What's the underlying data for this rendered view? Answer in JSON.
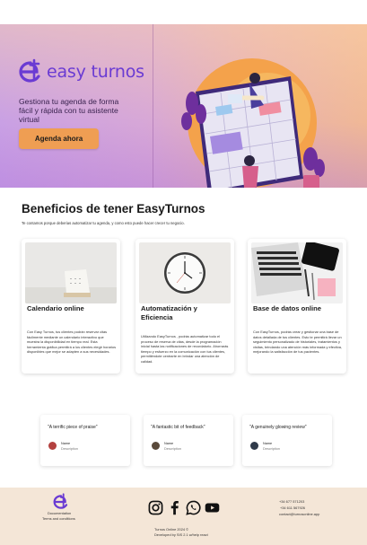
{
  "brand": {
    "name": "easy turnos"
  },
  "hero": {
    "tagline": "Gestiona tu agenda de forma fácil y rápida con tu asistente virtual",
    "cta_label": "Agenda ahora"
  },
  "benefits": {
    "title": "Beneficios de tener EasyTurnos",
    "subtitle": "Te contamos porque deberias automatizar tu agenda, y como esto puede hacer crecer tu negocio.",
    "cards": [
      {
        "title": "Calendario online",
        "body": "Con Easy Turnos, tus clientes podrán reservar citas fácilmente mediante un calendario interactivo que muestra la disponibilidad en tiempo real. Esta herramienta gráfica permitirá a los clientes elegir horarios disponibles que mejor se adapten a sus necesidades."
      },
      {
        "title": "Automatización y Eficiencia",
        "body": "Utilizando EasyTurnos , podrás automatizar todo el proceso de reserva de citas, desde la programación inicial hasta las notificaciones de recordatorio. Ahorrarás tiempo y esfuerzo en la comunicación con tus clientes, permitiéndote centrarte en brindar una atención de calidad."
      },
      {
        "title": "Base de datos online",
        "body": "Con EasyTurnos, podrás crear y gestionar una base de datos detallada de tus clientes. Esto te permitirá llevar un seguimiento personalizado de historiales, tratamientos y visitas, brindando una atención más informada y efectiva, mejorando la satisfacción de tus pacientes."
      }
    ]
  },
  "reviews": [
    {
      "quote": "\"A terrific piece of praise\"",
      "name": "Name",
      "description": "Description",
      "avatar_color": "#b3413f"
    },
    {
      "quote": "\"A fantastic bit of feedback\"",
      "name": "Name",
      "description": "Description",
      "avatar_color": "#5a4a3b"
    },
    {
      "quote": "\"A genuinely glowing review\"",
      "name": "Name",
      "description": "Description",
      "avatar_color": "#2f3a4a"
    }
  ],
  "footer": {
    "links": [
      "Documentation",
      "Terms and conditions"
    ],
    "socials": [
      "instagram-icon",
      "facebook-icon",
      "whatsapp-icon",
      "youtube-icon"
    ],
    "copyright": "Turnos Online 2024 ©",
    "developer": "Developed by SIS 2.1 w/help react",
    "contact": [
      "+34 677 571203",
      "+34 611 567926",
      "contact@turnosonline.app"
    ]
  },
  "colors": {
    "brand": "#6a3bd3",
    "cta": "#ef9e53",
    "footer": "#f4e6d7"
  }
}
